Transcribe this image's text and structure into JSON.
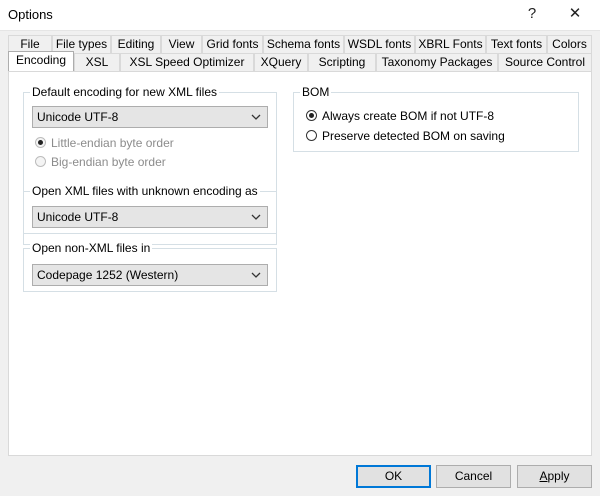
{
  "window": {
    "title": "Options",
    "help_glyph": "?",
    "close_glyph": "✕"
  },
  "tabs_row1": [
    "File",
    "File types",
    "Editing",
    "View",
    "Grid fonts",
    "Schema fonts",
    "WSDL fonts",
    "XBRL Fonts",
    "Text fonts",
    "Colors"
  ],
  "tabs_row2": [
    "Encoding",
    "XSL",
    "XSL Speed Optimizer",
    "XQuery",
    "Scripting",
    "Taxonomy Packages",
    "Source Control"
  ],
  "active_tab": "Encoding",
  "encoding": {
    "default_group": {
      "legend": "Default encoding for new XML files",
      "selected": "Unicode UTF-8",
      "byte_order": [
        {
          "label": "Little-endian byte order",
          "checked": true,
          "enabled": false
        },
        {
          "label": "Big-endian byte order",
          "checked": false,
          "enabled": false
        }
      ]
    },
    "unknown_group": {
      "legend": "Open XML files with unknown encoding as",
      "selected": "Unicode UTF-8"
    },
    "nonxml_group": {
      "legend": "Open non-XML files in",
      "selected": "Codepage 1252 (Western)"
    },
    "bom_group": {
      "legend": "BOM",
      "options": [
        {
          "label": "Always create BOM if not UTF-8",
          "checked": true
        },
        {
          "label": "Preserve detected BOM on saving",
          "checked": false
        }
      ]
    }
  },
  "buttons": {
    "ok": "OK",
    "cancel": "Cancel",
    "apply_rest": "pply",
    "apply_first": "A"
  },
  "icons": {
    "chevron": "chevron-down-icon"
  }
}
